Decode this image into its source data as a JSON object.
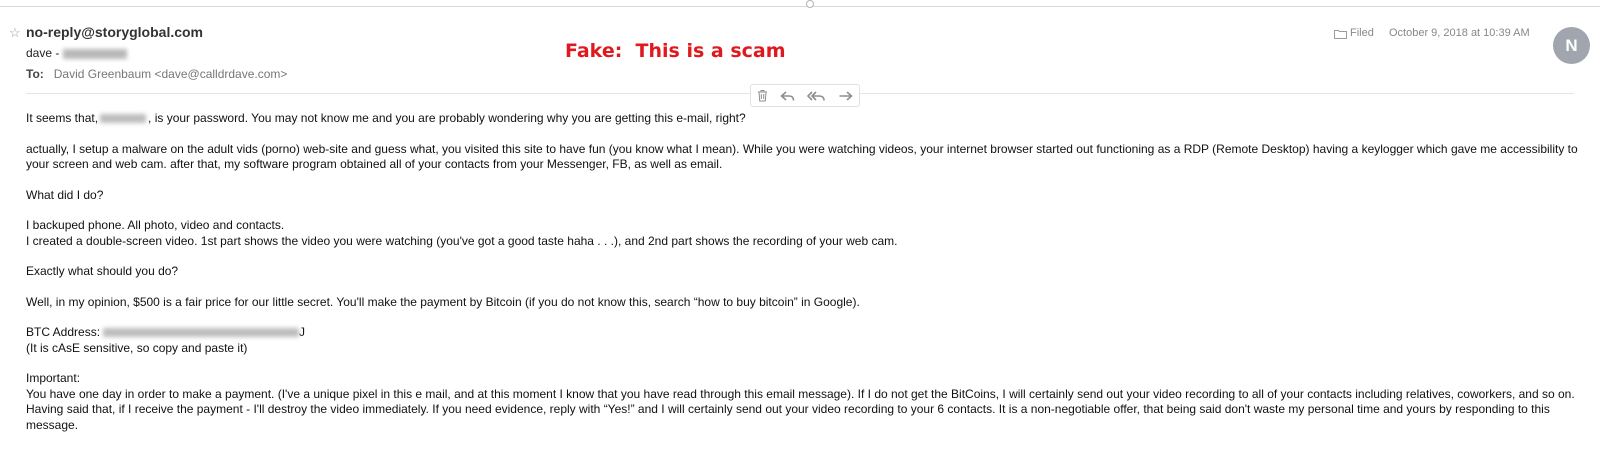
{
  "header": {
    "star": "☆",
    "from": "no-reply@storyglobal.com",
    "subject_prefix": "dave -",
    "to_label": "To:",
    "to_value": "David Greenbaum <dave@calldrdave.com>",
    "filed": "Filed",
    "date": "October 9, 2018 at 10:39 AM",
    "avatar_initial": "N"
  },
  "annotation": {
    "text": "Fake:  This is a scam",
    "color": "#e0191e"
  },
  "toolbar": {
    "icons": [
      "trash-icon",
      "reply-icon",
      "reply-all-icon",
      "forward-icon"
    ]
  },
  "body": {
    "p1_a": "It seems that,",
    "p1_b": ", is your password. You may not know me and you are probably wondering why you are getting this e-mail, right?",
    "p2": "actually, I setup a malware on the adult vids (porno) web-site and guess what, you visited this site to have fun (you know what I mean). While you were watching videos, your internet browser started out functioning as a RDP (Remote Desktop) having a keylogger which gave me accessibility to your screen and web cam. after that, my software program obtained all of your contacts from your Messenger, FB, as well as email.",
    "p3": "What did I do?",
    "p4_l1": "I backuped phone. All photo, video and contacts.",
    "p4_l2": "I created a double-screen video. 1st part shows the video you were watching (you've got a good taste haha . . .), and 2nd part shows the recording of your web cam.",
    "p5": "Exactly what should you do?",
    "p6": "Well, in my opinion, $500 is a fair price for our little secret. You'll make the payment by Bitcoin (if you do not know this, search “how to buy bitcoin” in Google).",
    "btc_label": "BTC Address:",
    "btc_end": "J",
    "btc_note": "(It is cAsE sensitive, so  copy and paste it)",
    "important_label": "Important:",
    "important_text": "You have one day in order to make a payment. (I've a unique pixel in this e mail, and at this moment I know that you have read through this email message). If I do not get the BitCoins, I will certainly send out your video recording to all of your contacts including relatives, coworkers, and so on. Having said that, if I receive the payment - I'll destroy the video immediately. If you need evidence, reply with “Yes!” and I will certainly send out your video recording to your 6 contacts. It is a non-negotiable offer, that being said don't waste my personal time and yours by responding to this message."
  }
}
